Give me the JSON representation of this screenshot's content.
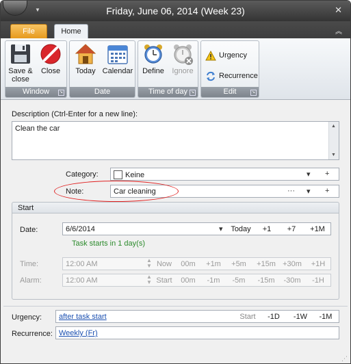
{
  "window": {
    "title": "Friday, June 06, 2014 (Week 23)",
    "close_glyph": "✕"
  },
  "tabs": [
    {
      "label": "File"
    },
    {
      "label": "Home"
    }
  ],
  "ribbon": {
    "groups": [
      {
        "label": "Window",
        "buttons": [
          {
            "label_line1": "Save &",
            "label_line2": "close",
            "icon": "floppy-disk-icon"
          },
          {
            "label": "Close",
            "icon": "no-entry-icon"
          }
        ]
      },
      {
        "label": "Date",
        "buttons": [
          {
            "label": "Today",
            "icon": "house-icon"
          },
          {
            "label": "Calendar",
            "icon": "calendar-icon"
          }
        ]
      },
      {
        "label": "Time of day",
        "buttons": [
          {
            "label": "Define",
            "icon": "alarm-clock-icon"
          },
          {
            "label": "Ignore",
            "icon": "alarm-clock-disabled-icon"
          }
        ]
      },
      {
        "label": "Edit",
        "buttons": [
          {
            "label": "Urgency",
            "icon": "warning-icon"
          },
          {
            "label": "Recurrence",
            "icon": "recurrence-icon"
          }
        ]
      }
    ]
  },
  "description": {
    "label": "Description (Ctrl-Enter for a new line):",
    "value": "Clean the car"
  },
  "category": {
    "label": "Category:",
    "value": "Keine"
  },
  "note": {
    "label": "Note:",
    "value": "Car cleaning",
    "ellipsis": "···"
  },
  "dropdown_glyph": "▾",
  "plus_glyph": "+",
  "start": {
    "header": "Start",
    "date_label": "Date:",
    "date_value": "6/6/2014",
    "date_offsets": [
      "Today",
      "+1",
      "+7",
      "+1M"
    ],
    "info": "Task starts in 1 day(s)",
    "time_label": "Time:",
    "time_value": "12:00 AM",
    "time_offsets": [
      "Now",
      "00m",
      "+1m",
      "+5m",
      "+15m",
      "+30m",
      "+1H"
    ],
    "alarm_label": "Alarm:",
    "alarm_value": "12:00 AM",
    "alarm_offsets": [
      "Start",
      "00m",
      "-1m",
      "-5m",
      "-15m",
      "-30m",
      "-1H"
    ]
  },
  "urgency": {
    "label": "Urgency:",
    "value": "after task start",
    "offsets": [
      "Start",
      "-1D",
      "-1W",
      "-1M"
    ]
  },
  "recurrence": {
    "label": "Recurrence:",
    "value": "Weekly (Fr)"
  },
  "colors": {
    "file_tab": "#e69a1d",
    "titlebar": "#343434",
    "info_green": "#2b8a2b",
    "link_blue": "#1a4fb0",
    "highlight_ellipse": "#e02020"
  }
}
